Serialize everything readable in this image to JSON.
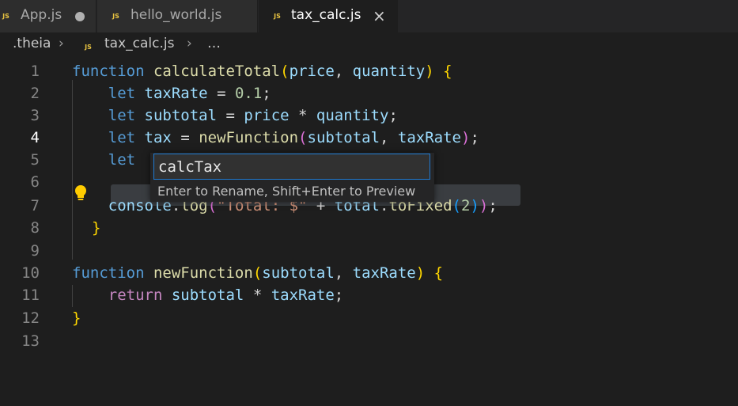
{
  "tabs": [
    {
      "label": "App.js",
      "icon": "js-file-icon",
      "dirty": true,
      "active": false
    },
    {
      "label": "hello_world.js",
      "icon": "js-file-icon",
      "active": false
    },
    {
      "label": "tax_calc.js",
      "icon": "js-file-icon",
      "active": true,
      "close": "×"
    }
  ],
  "tab_icon_text": "JS",
  "breadcrumb": {
    "root": ".theia",
    "file": "tax_calc.js",
    "more": "…",
    "sep": "›"
  },
  "line_numbers": [
    "1",
    "2",
    "3",
    "4",
    "5",
    "6",
    "7",
    "8",
    "9",
    "10",
    "11",
    "12",
    "13"
  ],
  "current_line": "4",
  "rename": {
    "value": "calcTax",
    "hint": "Enter to Rename, Shift+Enter to Preview"
  },
  "colors": {
    "keyword": "#569cd6",
    "function": "#dcdcaa",
    "variable": "#9cdcfe",
    "number": "#b5cea8",
    "string": "#ce9178",
    "bracket": "#ffd700",
    "focus_border": "#1f7ad1",
    "lightbulb": "#ffcc00"
  }
}
